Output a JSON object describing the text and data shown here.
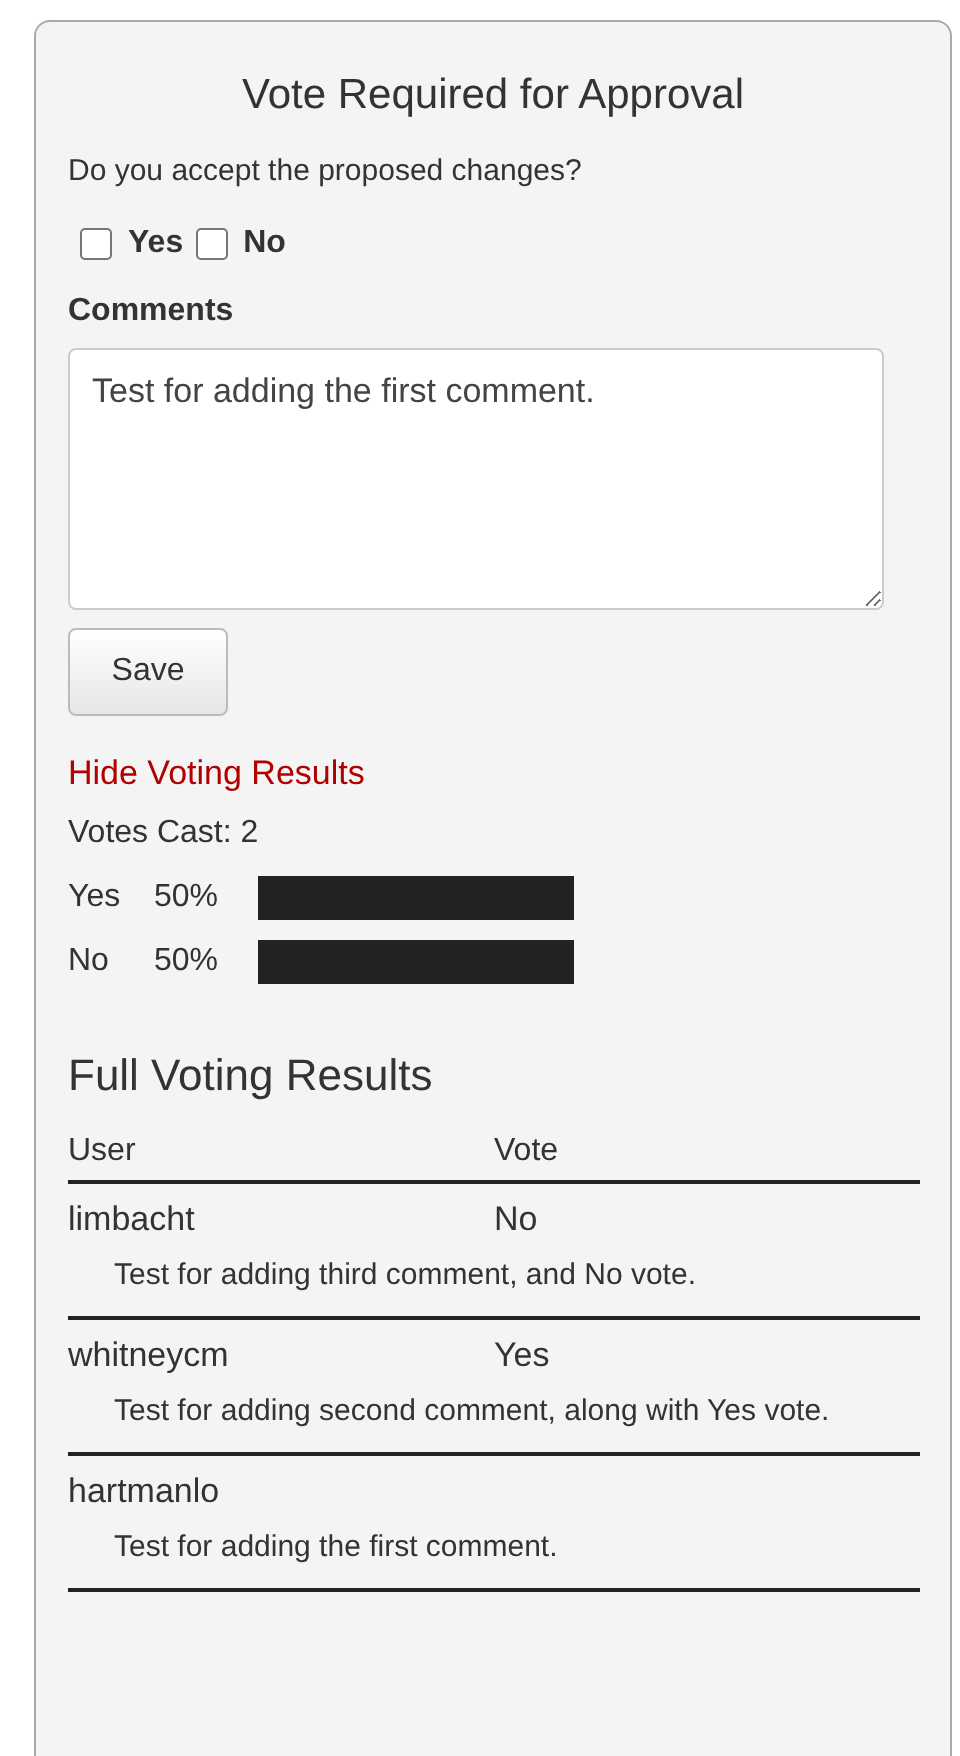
{
  "title": "Vote Required for Approval",
  "question": "Do you accept the proposed changes?",
  "options": [
    {
      "label": "Yes",
      "checked": false
    },
    {
      "label": "No",
      "checked": false
    }
  ],
  "comments": {
    "label": "Comments",
    "value": "Test for adding the first comment."
  },
  "save_button": "Save",
  "toggle_link": "Hide Voting Results",
  "votes_cast": "Votes Cast: 2",
  "results": [
    {
      "label": "Yes",
      "percent": "50%",
      "level": 0.5
    },
    {
      "label": "No",
      "percent": "50%",
      "level": 0.5
    }
  ],
  "full_results": {
    "heading": "Full Voting Results",
    "columns": [
      "User",
      "Vote"
    ],
    "rows": [
      {
        "user": "limbacht",
        "vote": "No",
        "comment": "Test for adding third comment, and No vote."
      },
      {
        "user": "whitneycm",
        "vote": "Yes",
        "comment": "Test for adding second comment, along with Yes vote."
      },
      {
        "user": "hartmanlo",
        "comment": "Test for adding the first comment."
      }
    ]
  }
}
